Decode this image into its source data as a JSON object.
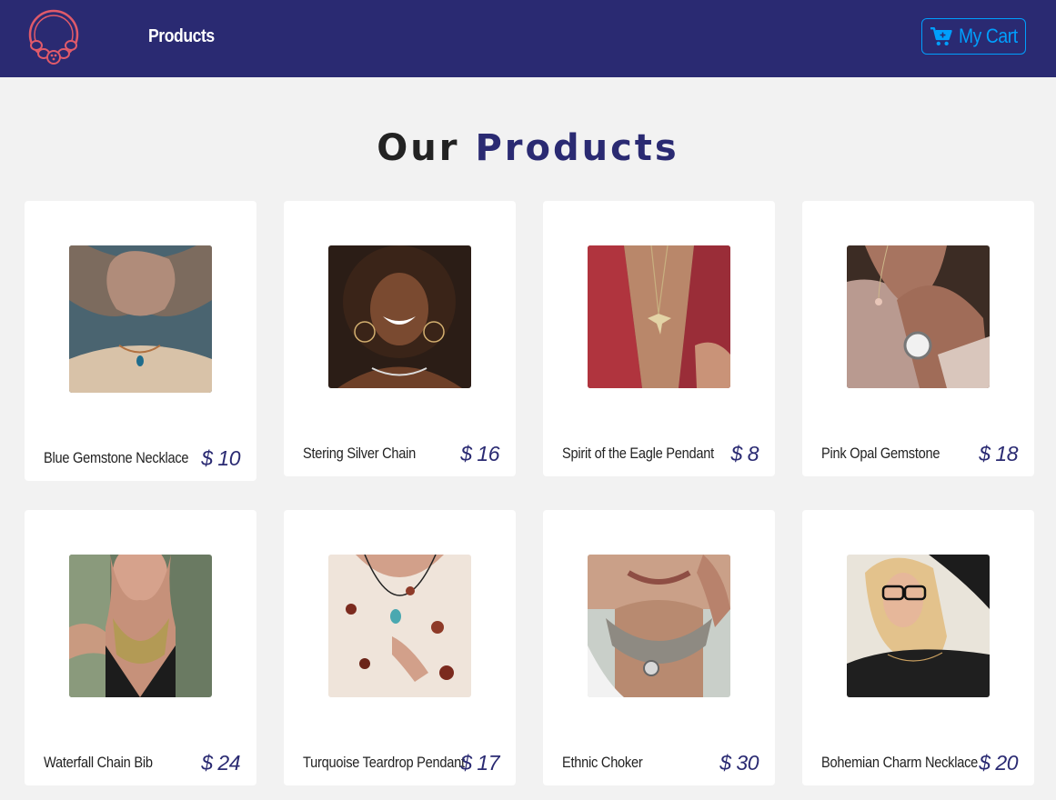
{
  "navbar": {
    "logo_icon": "necklace-logo-icon",
    "nav_link": "Products",
    "cart_icon": "cart-icon",
    "cart_label": "My Cart",
    "colors": {
      "background": "#2a2a72",
      "logo": "#e05a6a",
      "cart": "#009ffd"
    }
  },
  "heading": {
    "word1": "Our",
    "word2": "Products"
  },
  "products": [
    {
      "name": "Blue Gemstone Necklace",
      "price": "$ 10"
    },
    {
      "name": "Stering Silver Chain",
      "price": "$ 16"
    },
    {
      "name": "Spirit of the Eagle Pendant",
      "price": "$ 8"
    },
    {
      "name": "Pink Opal Gemstone",
      "price": "$ 18"
    },
    {
      "name": "Waterfall Chain Bib",
      "price": "$ 24"
    },
    {
      "name": "Turquoise Teardrop Pendant",
      "price": "$ 17"
    },
    {
      "name": "Ethnic Choker",
      "price": "$ 30"
    },
    {
      "name": "Bohemian Charm Necklace",
      "price": "$ 20"
    }
  ]
}
